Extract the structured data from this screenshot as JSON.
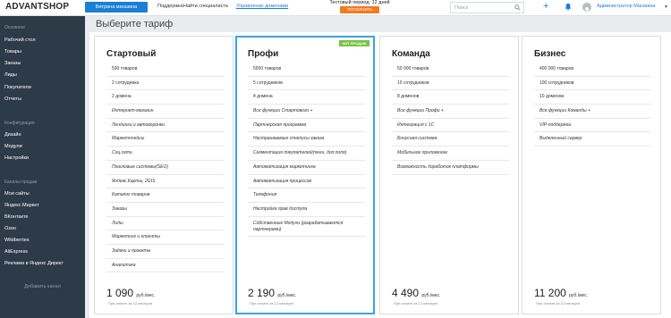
{
  "header": {
    "logo": "ADVANTSHOP",
    "store_button": "Витрина магазина",
    "nav": [
      "Поддержка",
      "Найти специалиста",
      "Управление доменами"
    ],
    "trial_text": "Тестовый период: 12 дней",
    "trial_button": "ПОПОЛНИТЬ",
    "search_placeholder": "Поиск",
    "admin_name": "Администратор Магазина"
  },
  "sidebar": {
    "section_main": "Основное",
    "main_items": [
      "Рабочий стол",
      "Товары",
      "Заказы",
      "Лиды",
      "Покупатели",
      "Отчеты"
    ],
    "section_config": "Конфигурация",
    "config_items": [
      "Дизайн",
      "Модули",
      "Настройки"
    ],
    "section_channels": "Каналы продаж",
    "channel_items": [
      "Мои сайты",
      "Яндекс.Маркет",
      "ВКонтакте",
      "Озон",
      "Wildberries",
      "AliExpress",
      "Реклама в Яндекс Директ"
    ],
    "add_channel": "Добавить канал"
  },
  "page": {
    "title": "Выберите тариф"
  },
  "plans": [
    {
      "name": "Стартовый",
      "badge": "",
      "features": [
        "500 товаров",
        "2 сотрудника",
        "2 домена",
        "Интернет-магазин",
        "Лендинги и автоворонки",
        "Маркетплейсы",
        "Соц.сети",
        "Поисковые системы(SEO)",
        "Яндекс.Карты, 2GIS",
        "Каталог товаров",
        "Заказы",
        "Лиды",
        "Маркетинг и клиенты",
        "Задачи и проекты",
        "Аналитика"
      ],
      "price": "1 090",
      "unit": "руб./мес.",
      "note": "При оплате за 12 месяцев"
    },
    {
      "name": "Профи",
      "badge": "ХИТ ПРОДАЖ",
      "features": [
        "5000 товаров",
        "5 сотрудников",
        "4 домена",
        "Все функции Стартового +",
        "Партнерская программа",
        "Настраиваемые статусы заказа",
        "Сегментация покупателей(теги, доп.поля)",
        "Автоматизация маркетинга",
        "Автоматизация процессов",
        "Телефония",
        "Настройка прав доступа",
        "Собственные Модули (разрабатываются партнерами)"
      ],
      "price": "2 190",
      "unit": "руб./мес.",
      "note": "При оплате за 12 месяцев"
    },
    {
      "name": "Команда",
      "badge": "",
      "features": [
        "50 000 товаров",
        "10 сотрудников",
        "8 доменов",
        "Все функции Профи +",
        "Интеграция с 1С",
        "Бонусная система",
        "Мобильное приложение",
        "Возможность доработок платформы"
      ],
      "price": "4 490",
      "unit": "руб./мес.",
      "note": "При оплате за 12 месяцев"
    },
    {
      "name": "Бизнес",
      "badge": "",
      "features": [
        "400 000 товаров",
        "100 сотрудников",
        "10 доменов",
        "Все функции Команды +",
        "VIP-поддержка",
        "Выделенный сервер"
      ],
      "price": "11 200",
      "unit": "руб./мес.",
      "note": "При оплате за 12 месяцев"
    }
  ]
}
